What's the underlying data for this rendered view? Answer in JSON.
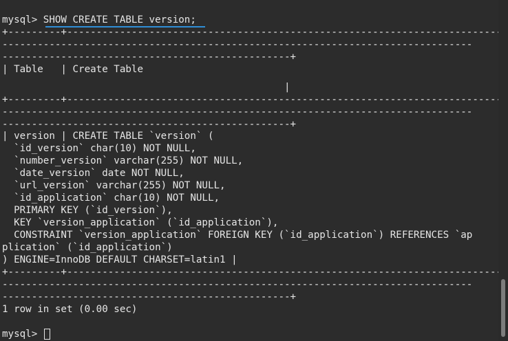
{
  "terminal": {
    "lines": [
      "mysql> SHOW CREATE TABLE version;",
      "+---------+------------------------------------------------------------------------------",
      "--------------------------------------------------------------------------------",
      "-------------------------------------------------+",
      "| Table   | Create Table",
      "                                                |",
      "+---------+------------------------------------------------------------------------------",
      "--------------------------------------------------------------------------------",
      "-------------------------------------------------+",
      "| version | CREATE TABLE `version` (",
      "  `id_version` char(10) NOT NULL,",
      "  `number_version` varchar(255) NOT NULL,",
      "  `date_version` date NOT NULL,",
      "  `url_version` varchar(255) NOT NULL,",
      "  `id_application` char(10) NOT NULL,",
      "  PRIMARY KEY (`id_version`),",
      "  KEY `version_application` (`id_application`),",
      "  CONSTRAINT `version_application` FOREIGN KEY (`id_application`) REFERENCES `ap",
      "plication` (`id_application`)",
      ") ENGINE=InnoDB DEFAULT CHARSET=latin1 |",
      "+---------+------------------------------------------------------------------------------",
      "--------------------------------------------------------------------------------",
      "-------------------------------------------------+",
      "1 row in set (0.00 sec)",
      "",
      "mysql> "
    ]
  },
  "colors": {
    "background": "#2c2c2c",
    "text": "#e6e6e6",
    "underline_accent": "#2f8fd8"
  }
}
